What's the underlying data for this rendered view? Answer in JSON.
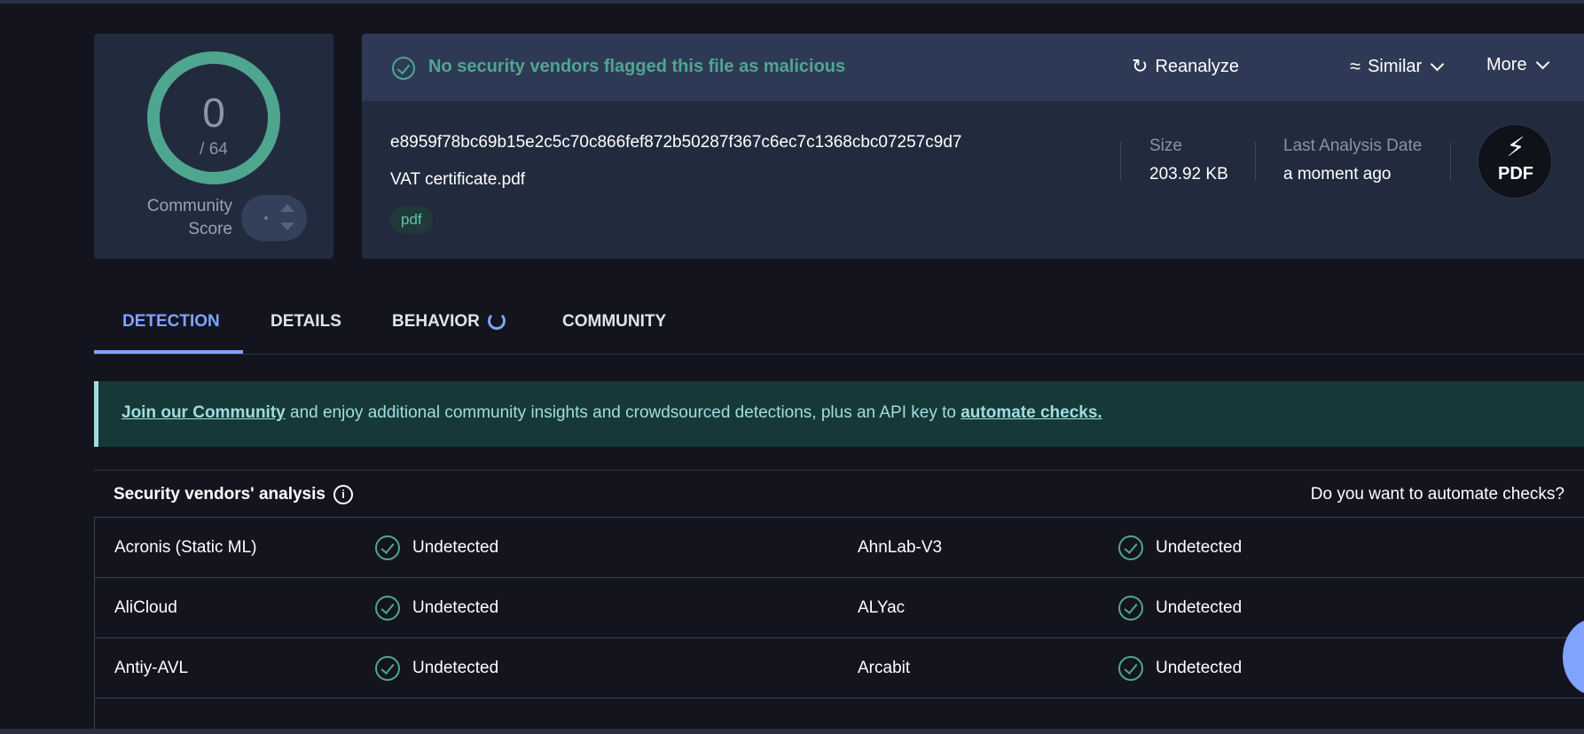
{
  "score": {
    "detections": "0",
    "total": "/ 64",
    "community_label": "Community Score"
  },
  "status": {
    "text": "No security vendors flagged this file as malicious"
  },
  "actions": {
    "reanalyze": "Reanalyze",
    "similar": "Similar",
    "more": "More"
  },
  "file": {
    "hash": "e8959f78bc69b15e2c5c70c866fef872b50287f367c6ec7c1368cbc07257c9d7",
    "name": "VAT certificate.pdf",
    "tag": "pdf",
    "size_label": "Size",
    "size_value": "203.92 KB",
    "date_label": "Last Analysis Date",
    "date_value": "a moment ago",
    "type_badge": "PDF"
  },
  "tabs": [
    "DETECTION",
    "DETAILS",
    "BEHAVIOR",
    "COMMUNITY"
  ],
  "banner": {
    "link1": "Join our Community",
    "middle": " and enjoy additional community insights and crowdsourced detections, plus an API key to ",
    "link2": "automate checks."
  },
  "vendors": {
    "title": "Security vendors' analysis",
    "automate_link": "Do you want to automate checks?",
    "rows": [
      {
        "left": {
          "name": "Acronis (Static ML)",
          "result": "Undetected"
        },
        "right": {
          "name": "AhnLab-V3",
          "result": "Undetected"
        }
      },
      {
        "left": {
          "name": "AliCloud",
          "result": "Undetected"
        },
        "right": {
          "name": "ALYac",
          "result": "Undetected"
        }
      },
      {
        "left": {
          "name": "Antiy-AVL",
          "result": "Undetected"
        },
        "right": {
          "name": "Arcabit",
          "result": "Undetected"
        }
      }
    ]
  },
  "colors": {
    "accent": "#7fa3ff",
    "clean": "#4fa68e",
    "banner_text": "#9fdde0"
  }
}
